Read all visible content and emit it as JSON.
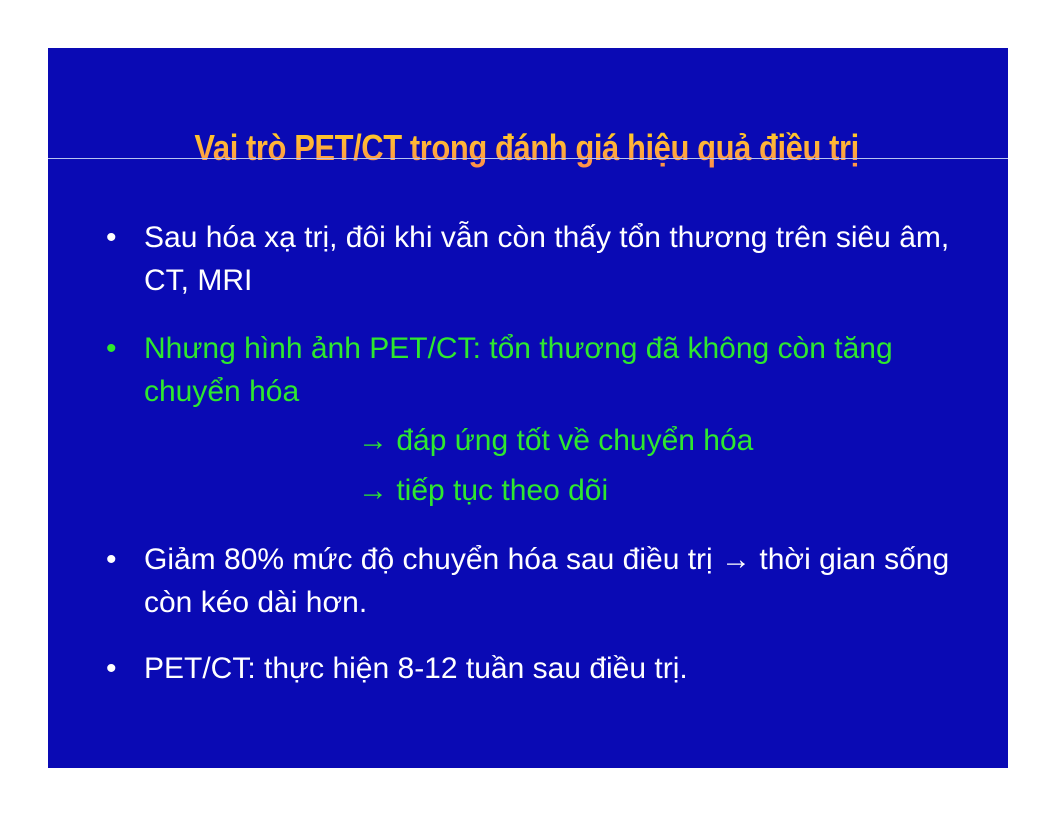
{
  "slide": {
    "title": "Vai trò PET/CT trong đánh giá hiệu quả điều trị",
    "bullets": [
      {
        "marker": "•",
        "text": "Sau hóa xạ trị, đôi khi vẫn còn thấy tổn thương trên siêu âm, CT, MRI",
        "color": "#ffffff"
      },
      {
        "marker": "•",
        "text": "Nhưng hình ảnh PET/CT: tổn thương đã không còn tăng chuyển hóa",
        "color": "#2ee82e",
        "sub_items": [
          "→ đáp ứng tốt về chuyển hóa",
          "→ tiếp tục theo dõi"
        ]
      },
      {
        "marker": "•",
        "text": "Giảm 80% mức độ chuyển hóa sau điều trị → thời gian sống còn kéo dài hơn.",
        "color": "#ffffff"
      },
      {
        "marker": "•",
        "text": "PET/CT: thực hiện 8-12 tuần sau điều trị.",
        "color": "#ffffff"
      }
    ]
  },
  "colors": {
    "slide_background": "#0a0ab4",
    "title_gradient_top": "#ffd21e",
    "title_gradient_bottom": "#ff8f4a",
    "divider": "#b8c4f0"
  }
}
